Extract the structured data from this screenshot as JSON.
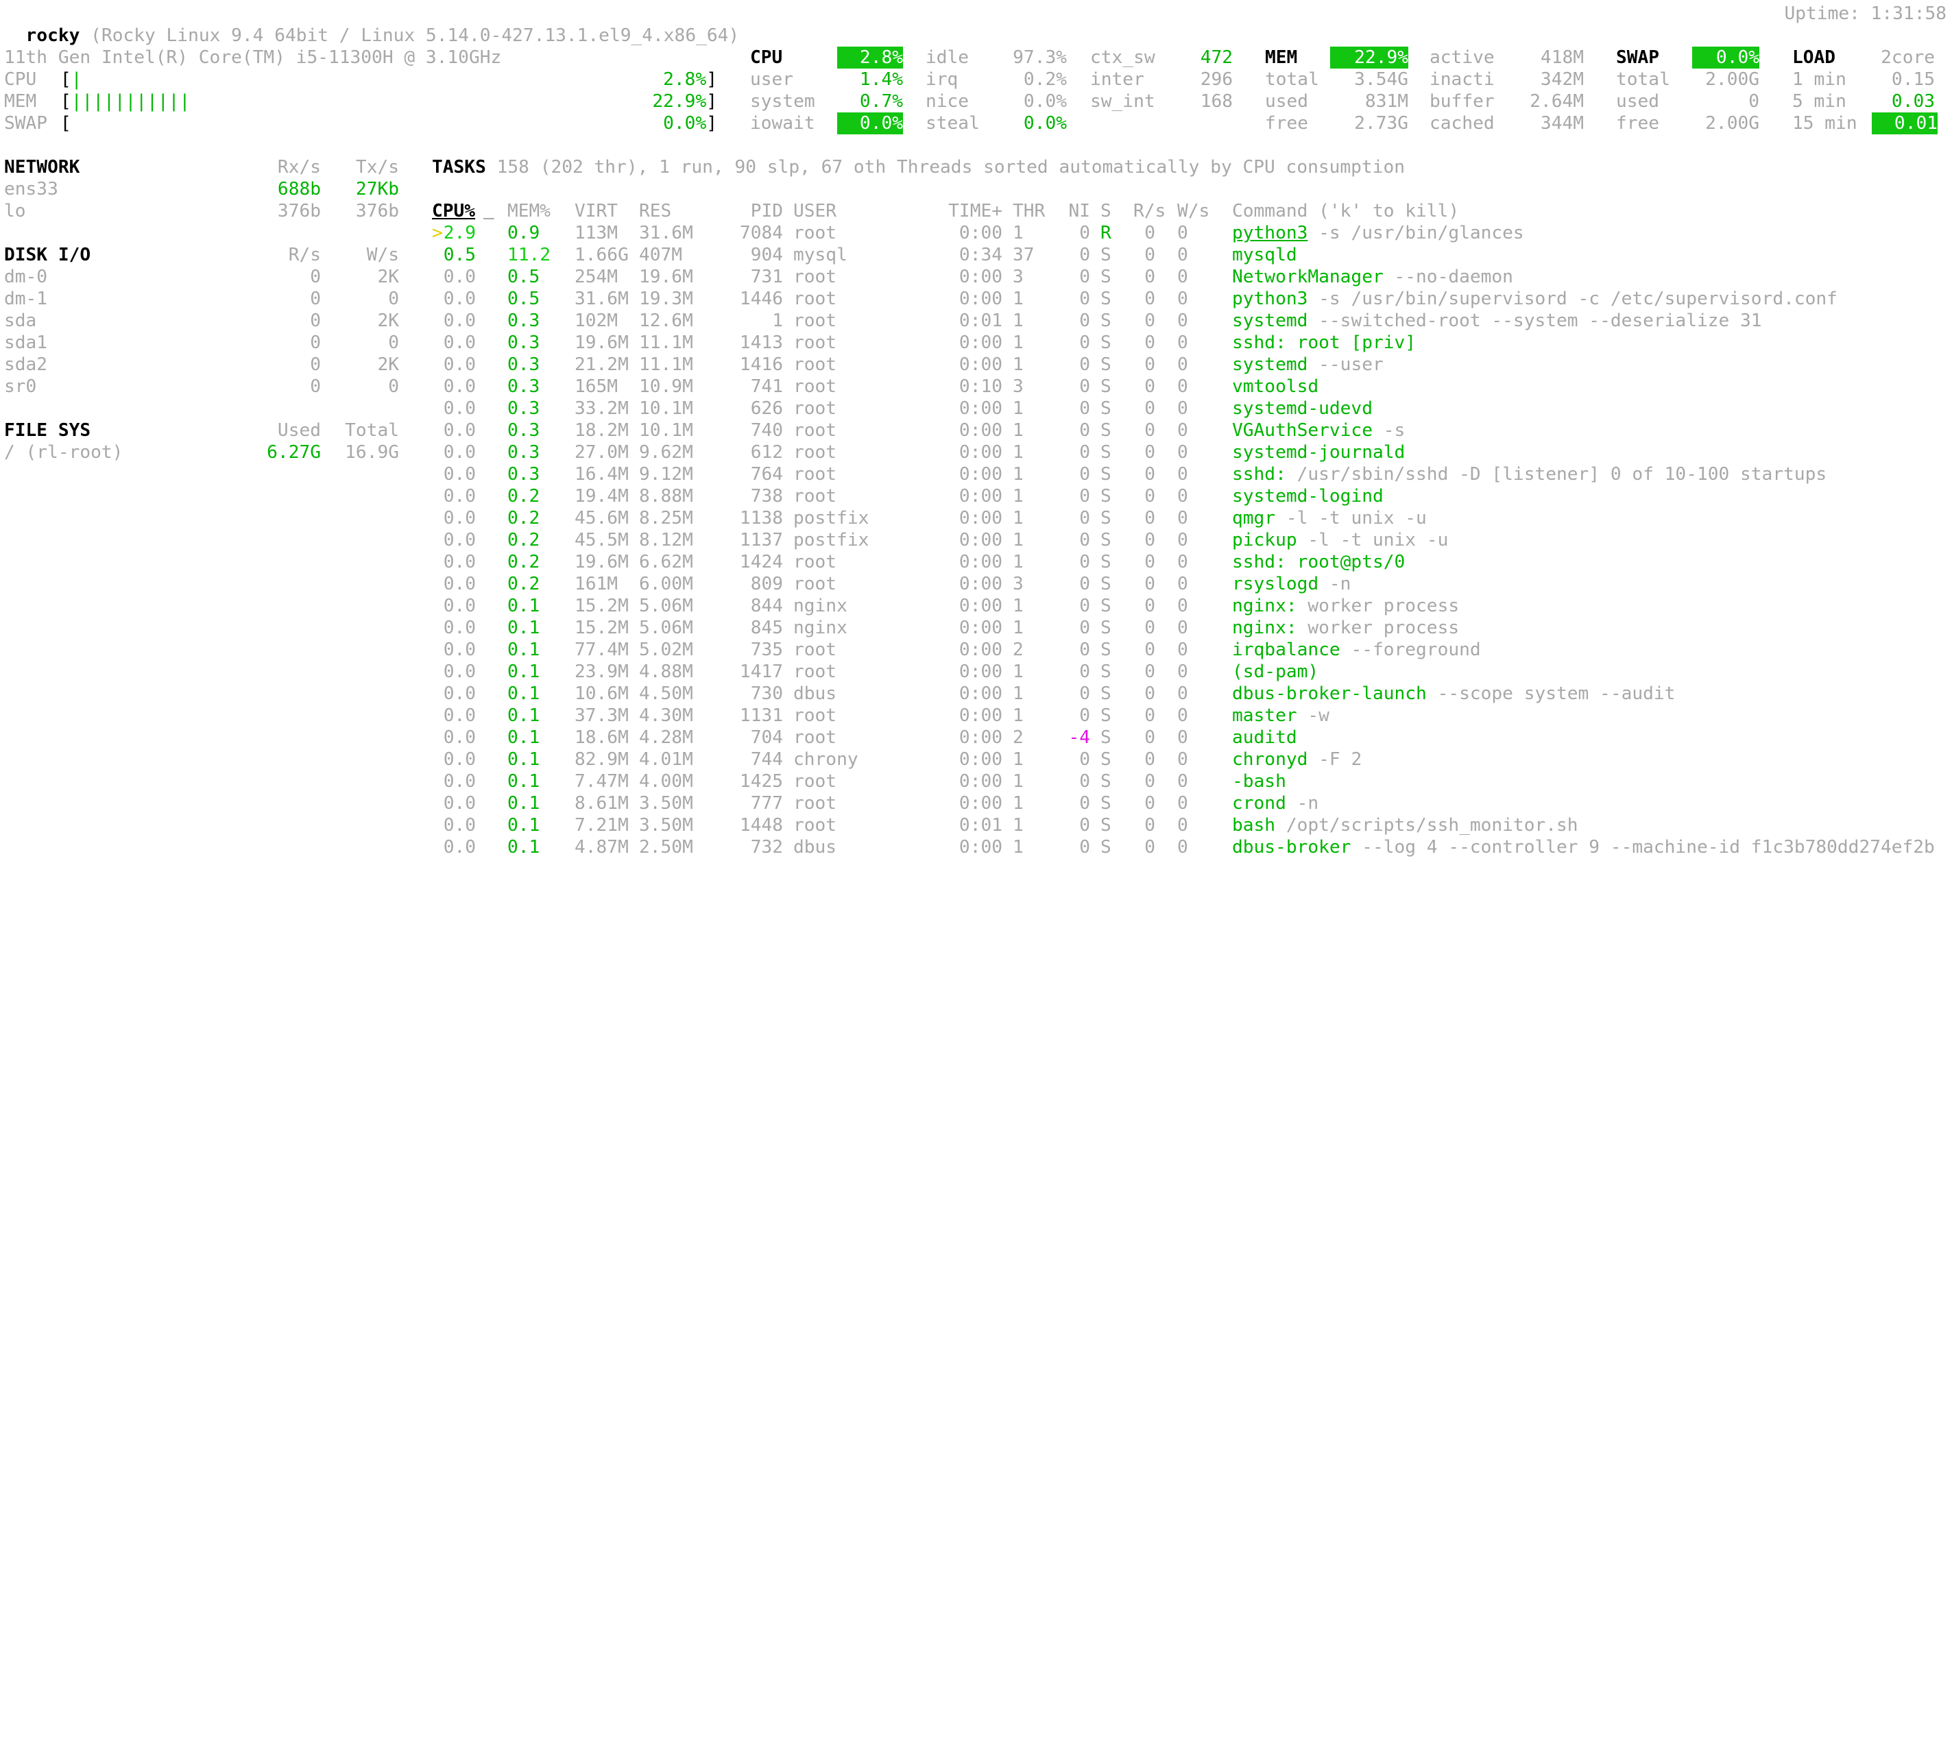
{
  "header": {
    "hostname": "rocky",
    "system": "(Rocky Linux 9.4 64bit / Linux 5.14.0-427.13.1.el9_4.x86_64)",
    "uptime": "Uptime: 1:31:58"
  },
  "quicklook": {
    "cpu_name": "11th Gen Intel(R) Core(TM) i5-11300H @ 3.10GHz",
    "cpu_label": "CPU",
    "cpu_bar": "|",
    "cpu_pct": "2.8%",
    "mem_label": "MEM",
    "mem_bar": "|||||||||||",
    "mem_pct": "22.9%",
    "swap_label": "SWAP",
    "swap_bar": "",
    "swap_pct": "0.0%"
  },
  "cpu": {
    "label": "CPU",
    "total": "2.8%",
    "user_l": "user",
    "user": "1.4%",
    "system_l": "system",
    "system": "0.7%",
    "iowait_l": "iowait",
    "iowait": "0.0%",
    "idle_l": "idle",
    "idle": "97.3%",
    "irq_l": "irq",
    "irq": "0.2%",
    "nice_l": "nice",
    "nice": "0.0%",
    "steal_l": "steal",
    "steal": "0.0%",
    "ctx_sw_l": "ctx_sw",
    "ctx_sw": "472",
    "inter_l": "inter",
    "inter": "296",
    "sw_int_l": "sw_int",
    "sw_int": "168"
  },
  "mem": {
    "label": "MEM",
    "pct": "22.9%",
    "total_l": "total",
    "total": "3.54G",
    "used_l": "used",
    "used": "831M",
    "free_l": "free",
    "free": "2.73G",
    "active_l": "active",
    "active": "418M",
    "inactive_l": "inacti",
    "inactive": "342M",
    "buffer_l": "buffer",
    "buffer": "2.64M",
    "cached_l": "cached",
    "cached": "344M"
  },
  "swap": {
    "label": "SWAP",
    "pct": "0.0%",
    "total_l": "total",
    "total": "2.00G",
    "used_l": "used",
    "used": "0",
    "free_l": "free",
    "free": "2.00G"
  },
  "load": {
    "label": "LOAD",
    "cores": "2core",
    "min1_l": "1 min",
    "min1": "0.15",
    "min5_l": "5 min",
    "min5": "0.03",
    "min15_l": "15 min",
    "min15": "0.01"
  },
  "network": {
    "title": "NETWORK",
    "rx_h": "Rx/s",
    "tx_h": "Tx/s",
    "rows": [
      {
        "name": "ens33",
        "rx": "688b",
        "tx": "27Kb"
      },
      {
        "name": "lo",
        "rx": "376b",
        "tx": "376b"
      }
    ]
  },
  "diskio": {
    "title": "DISK I/O",
    "r_h": "R/s",
    "w_h": "W/s",
    "rows": [
      {
        "name": "dm-0",
        "r": "0",
        "w": "2K"
      },
      {
        "name": "dm-1",
        "r": "0",
        "w": "0"
      },
      {
        "name": "sda",
        "r": "0",
        "w": "2K"
      },
      {
        "name": "sda1",
        "r": "0",
        "w": "0"
      },
      {
        "name": "sda2",
        "r": "0",
        "w": "2K"
      },
      {
        "name": "sr0",
        "r": "0",
        "w": "0"
      }
    ]
  },
  "filesys": {
    "title": "FILE SYS",
    "used_h": "Used",
    "total_h": "Total",
    "rows": [
      {
        "name": "/ (rl-root)",
        "used": "6.27G",
        "total": "16.9G"
      }
    ]
  },
  "tasks": {
    "title": "TASKS",
    "summary": "158 (202 thr), 1 run, 90 slp, 67 oth Threads sorted automatically by CPU consumption"
  },
  "process_table": {
    "headers": {
      "cpu": "CPU%",
      "mem": "MEM%",
      "virt": "VIRT",
      "res": "RES",
      "pid": "PID",
      "user": "USER",
      "time": "TIME+",
      "thr": "THR",
      "ni": "NI",
      "s": "S",
      "rs": "R/s",
      "ws": "W/s",
      "cmd": "Command ('k' to kill)"
    },
    "cursor": ">",
    "rows": [
      {
        "cpu": "2.9",
        "mem": "0.9",
        "virt": "113M",
        "res": "31.6M",
        "pid": "7084",
        "user": "root",
        "time": "0:00",
        "thr": "1",
        "ni": "0",
        "s": "R",
        "rs": "0",
        "ws": "0",
        "cmd": "python3",
        "args": " -s /usr/bin/glances"
      },
      {
        "cpu": "0.5",
        "mem": "11.2",
        "virt": "1.66G",
        "res": "407M",
        "pid": "904",
        "user": "mysql",
        "time": "0:34",
        "thr": "37",
        "ni": "0",
        "s": "S",
        "rs": "0",
        "ws": "0",
        "cmd": "mysqld",
        "args": ""
      },
      {
        "cpu": "0.0",
        "mem": "0.5",
        "virt": "254M",
        "res": "19.6M",
        "pid": "731",
        "user": "root",
        "time": "0:00",
        "thr": "3",
        "ni": "0",
        "s": "S",
        "rs": "0",
        "ws": "0",
        "cmd": "NetworkManager",
        "args": " --no-daemon"
      },
      {
        "cpu": "0.0",
        "mem": "0.5",
        "virt": "31.6M",
        "res": "19.3M",
        "pid": "1446",
        "user": "root",
        "time": "0:00",
        "thr": "1",
        "ni": "0",
        "s": "S",
        "rs": "0",
        "ws": "0",
        "cmd": "python3",
        "args": " -s /usr/bin/supervisord -c /etc/supervisord.conf"
      },
      {
        "cpu": "0.0",
        "mem": "0.3",
        "virt": "102M",
        "res": "12.6M",
        "pid": "1",
        "user": "root",
        "time": "0:01",
        "thr": "1",
        "ni": "0",
        "s": "S",
        "rs": "0",
        "ws": "0",
        "cmd": "systemd",
        "args": " --switched-root --system --deserialize 31"
      },
      {
        "cpu": "0.0",
        "mem": "0.3",
        "virt": "19.6M",
        "res": "11.1M",
        "pid": "1413",
        "user": "root",
        "time": "0:00",
        "thr": "1",
        "ni": "0",
        "s": "S",
        "rs": "0",
        "ws": "0",
        "cmd": "sshd: root [priv]",
        "args": ""
      },
      {
        "cpu": "0.0",
        "mem": "0.3",
        "virt": "21.2M",
        "res": "11.1M",
        "pid": "1416",
        "user": "root",
        "time": "0:00",
        "thr": "1",
        "ni": "0",
        "s": "S",
        "rs": "0",
        "ws": "0",
        "cmd": "systemd",
        "args": " --user"
      },
      {
        "cpu": "0.0",
        "mem": "0.3",
        "virt": "165M",
        "res": "10.9M",
        "pid": "741",
        "user": "root",
        "time": "0:10",
        "thr": "3",
        "ni": "0",
        "s": "S",
        "rs": "0",
        "ws": "0",
        "cmd": "vmtoolsd",
        "args": ""
      },
      {
        "cpu": "0.0",
        "mem": "0.3",
        "virt": "33.2M",
        "res": "10.1M",
        "pid": "626",
        "user": "root",
        "time": "0:00",
        "thr": "1",
        "ni": "0",
        "s": "S",
        "rs": "0",
        "ws": "0",
        "cmd": "systemd-udevd",
        "args": ""
      },
      {
        "cpu": "0.0",
        "mem": "0.3",
        "virt": "18.2M",
        "res": "10.1M",
        "pid": "740",
        "user": "root",
        "time": "0:00",
        "thr": "1",
        "ni": "0",
        "s": "S",
        "rs": "0",
        "ws": "0",
        "cmd": "VGAuthService",
        "args": " -s"
      },
      {
        "cpu": "0.0",
        "mem": "0.3",
        "virt": "27.0M",
        "res": "9.62M",
        "pid": "612",
        "user": "root",
        "time": "0:00",
        "thr": "1",
        "ni": "0",
        "s": "S",
        "rs": "0",
        "ws": "0",
        "cmd": "systemd-journald",
        "args": ""
      },
      {
        "cpu": "0.0",
        "mem": "0.3",
        "virt": "16.4M",
        "res": "9.12M",
        "pid": "764",
        "user": "root",
        "time": "0:00",
        "thr": "1",
        "ni": "0",
        "s": "S",
        "rs": "0",
        "ws": "0",
        "cmd": "sshd:",
        "args": " /usr/sbin/sshd -D [listener] 0 of 10-100 startups"
      },
      {
        "cpu": "0.0",
        "mem": "0.2",
        "virt": "19.4M",
        "res": "8.88M",
        "pid": "738",
        "user": "root",
        "time": "0:00",
        "thr": "1",
        "ni": "0",
        "s": "S",
        "rs": "0",
        "ws": "0",
        "cmd": "systemd-logind",
        "args": ""
      },
      {
        "cpu": "0.0",
        "mem": "0.2",
        "virt": "45.6M",
        "res": "8.25M",
        "pid": "1138",
        "user": "postfix",
        "time": "0:00",
        "thr": "1",
        "ni": "0",
        "s": "S",
        "rs": "0",
        "ws": "0",
        "cmd": "qmgr",
        "args": " -l -t unix -u"
      },
      {
        "cpu": "0.0",
        "mem": "0.2",
        "virt": "45.5M",
        "res": "8.12M",
        "pid": "1137",
        "user": "postfix",
        "time": "0:00",
        "thr": "1",
        "ni": "0",
        "s": "S",
        "rs": "0",
        "ws": "0",
        "cmd": "pickup",
        "args": " -l -t unix -u"
      },
      {
        "cpu": "0.0",
        "mem": "0.2",
        "virt": "19.6M",
        "res": "6.62M",
        "pid": "1424",
        "user": "root",
        "time": "0:00",
        "thr": "1",
        "ni": "0",
        "s": "S",
        "rs": "0",
        "ws": "0",
        "cmd": "sshd: root@pts/0",
        "args": ""
      },
      {
        "cpu": "0.0",
        "mem": "0.2",
        "virt": "161M",
        "res": "6.00M",
        "pid": "809",
        "user": "root",
        "time": "0:00",
        "thr": "3",
        "ni": "0",
        "s": "S",
        "rs": "0",
        "ws": "0",
        "cmd": "rsyslogd",
        "args": " -n"
      },
      {
        "cpu": "0.0",
        "mem": "0.1",
        "virt": "15.2M",
        "res": "5.06M",
        "pid": "844",
        "user": "nginx",
        "time": "0:00",
        "thr": "1",
        "ni": "0",
        "s": "S",
        "rs": "0",
        "ws": "0",
        "cmd": "nginx:",
        "args": " worker process"
      },
      {
        "cpu": "0.0",
        "mem": "0.1",
        "virt": "15.2M",
        "res": "5.06M",
        "pid": "845",
        "user": "nginx",
        "time": "0:00",
        "thr": "1",
        "ni": "0",
        "s": "S",
        "rs": "0",
        "ws": "0",
        "cmd": "nginx:",
        "args": " worker process"
      },
      {
        "cpu": "0.0",
        "mem": "0.1",
        "virt": "77.4M",
        "res": "5.02M",
        "pid": "735",
        "user": "root",
        "time": "0:00",
        "thr": "2",
        "ni": "0",
        "s": "S",
        "rs": "0",
        "ws": "0",
        "cmd": "irqbalance",
        "args": " --foreground"
      },
      {
        "cpu": "0.0",
        "mem": "0.1",
        "virt": "23.9M",
        "res": "4.88M",
        "pid": "1417",
        "user": "root",
        "time": "0:00",
        "thr": "1",
        "ni": "0",
        "s": "S",
        "rs": "0",
        "ws": "0",
        "cmd": "(sd-pam)",
        "args": ""
      },
      {
        "cpu": "0.0",
        "mem": "0.1",
        "virt": "10.6M",
        "res": "4.50M",
        "pid": "730",
        "user": "dbus",
        "time": "0:00",
        "thr": "1",
        "ni": "0",
        "s": "S",
        "rs": "0",
        "ws": "0",
        "cmd": "dbus-broker-launch",
        "args": " --scope system --audit"
      },
      {
        "cpu": "0.0",
        "mem": "0.1",
        "virt": "37.3M",
        "res": "4.30M",
        "pid": "1131",
        "user": "root",
        "time": "0:00",
        "thr": "1",
        "ni": "0",
        "s": "S",
        "rs": "0",
        "ws": "0",
        "cmd": "master",
        "args": " -w"
      },
      {
        "cpu": "0.0",
        "mem": "0.1",
        "virt": "18.6M",
        "res": "4.28M",
        "pid": "704",
        "user": "root",
        "time": "0:00",
        "thr": "2",
        "ni": "-4",
        "s": "S",
        "rs": "0",
        "ws": "0",
        "cmd": "auditd",
        "args": ""
      },
      {
        "cpu": "0.0",
        "mem": "0.1",
        "virt": "82.9M",
        "res": "4.01M",
        "pid": "744",
        "user": "chrony",
        "time": "0:00",
        "thr": "1",
        "ni": "0",
        "s": "S",
        "rs": "0",
        "ws": "0",
        "cmd": "chronyd",
        "args": " -F 2"
      },
      {
        "cpu": "0.0",
        "mem": "0.1",
        "virt": "7.47M",
        "res": "4.00M",
        "pid": "1425",
        "user": "root",
        "time": "0:00",
        "thr": "1",
        "ni": "0",
        "s": "S",
        "rs": "0",
        "ws": "0",
        "cmd": "-bash",
        "args": ""
      },
      {
        "cpu": "0.0",
        "mem": "0.1",
        "virt": "8.61M",
        "res": "3.50M",
        "pid": "777",
        "user": "root",
        "time": "0:00",
        "thr": "1",
        "ni": "0",
        "s": "S",
        "rs": "0",
        "ws": "0",
        "cmd": "crond",
        "args": " -n"
      },
      {
        "cpu": "0.0",
        "mem": "0.1",
        "virt": "7.21M",
        "res": "3.50M",
        "pid": "1448",
        "user": "root",
        "time": "0:01",
        "thr": "1",
        "ni": "0",
        "s": "S",
        "rs": "0",
        "ws": "0",
        "cmd": "bash",
        "args": " /opt/scripts/ssh_monitor.sh"
      },
      {
        "cpu": "0.0",
        "mem": "0.1",
        "virt": "4.87M",
        "res": "2.50M",
        "pid": "732",
        "user": "dbus",
        "time": "0:00",
        "thr": "1",
        "ni": "0",
        "s": "S",
        "rs": "0",
        "ws": "0",
        "cmd": "dbus-broker",
        "args": " --log 4 --controller 9 --machine-id f1c3b780dd274ef2b"
      }
    ]
  },
  "colors": {
    "accent_green": "#11c511",
    "text_green": "#00b400",
    "dim": "#a8a8a8",
    "nice_negative": "#e010e0"
  }
}
